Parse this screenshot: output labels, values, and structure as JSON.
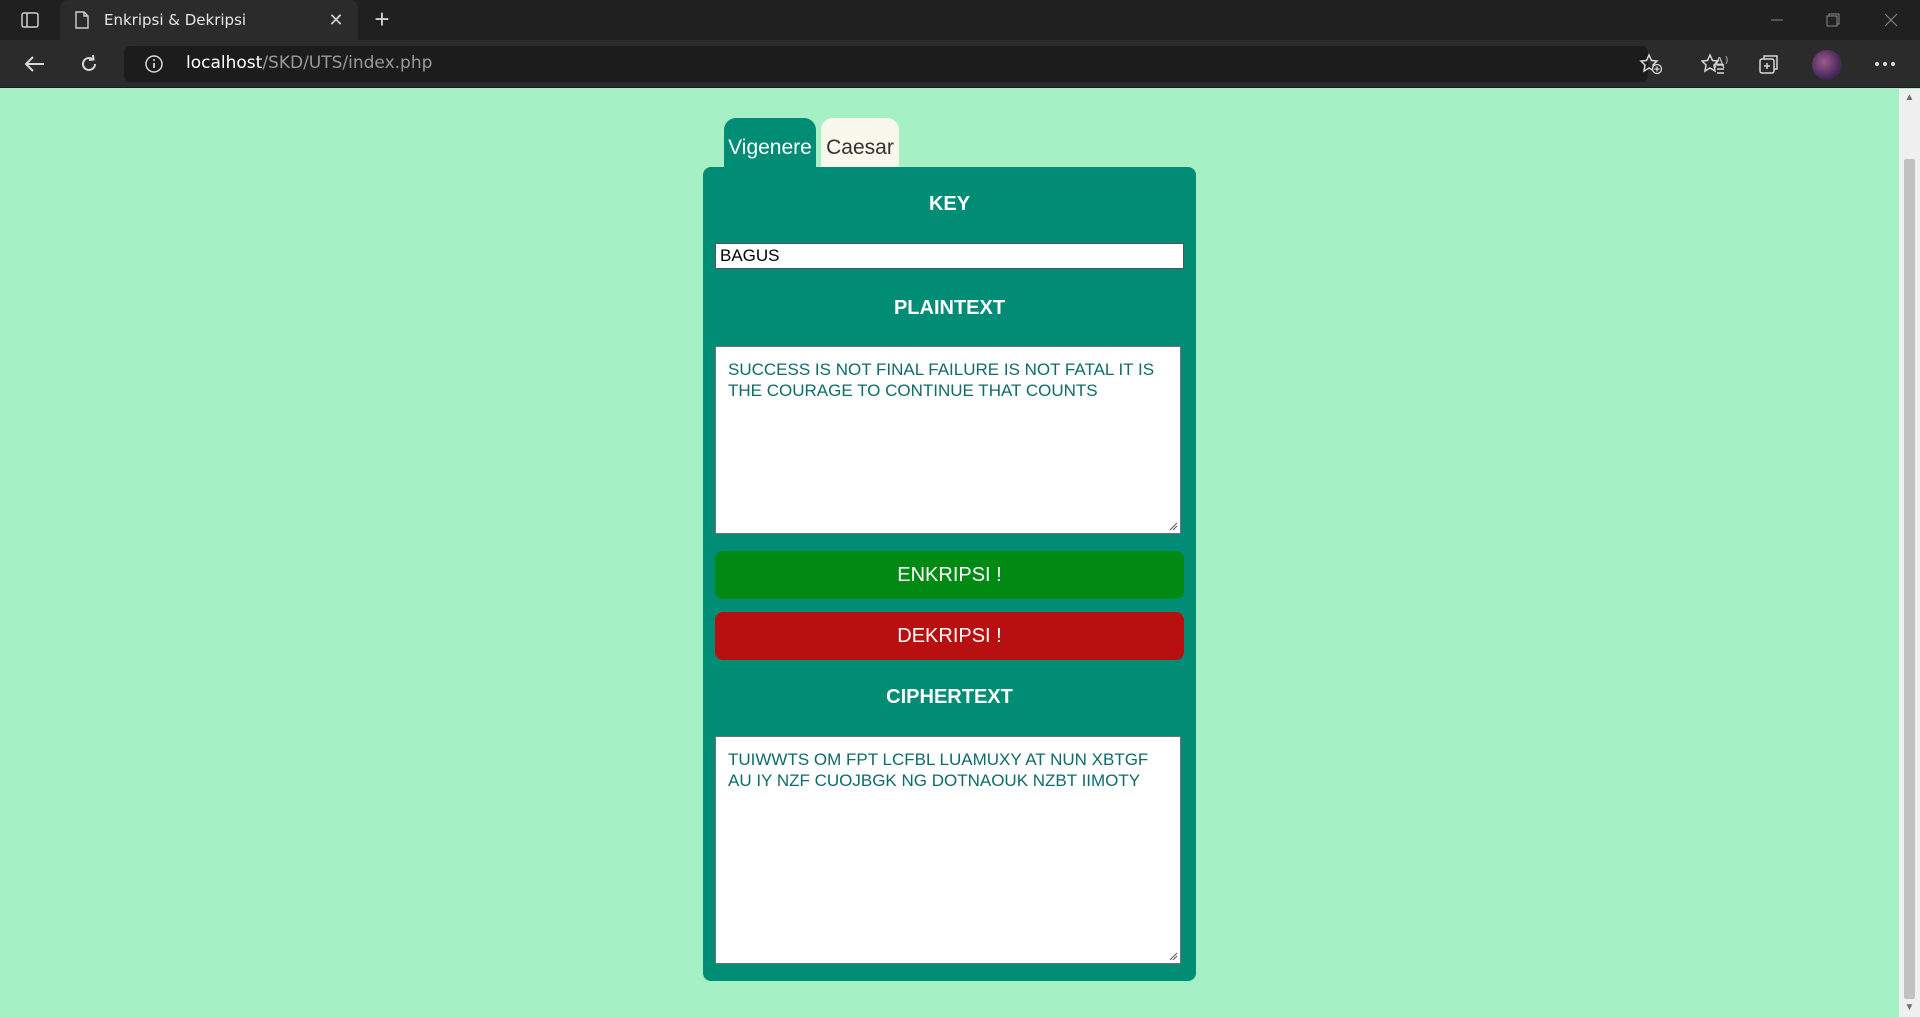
{
  "browser": {
    "tab_title": "Enkripsi & Dekripsi",
    "url_host": "localhost",
    "url_path": "/SKD/UTS/index.php",
    "read_aloud_icon_text": "A⁾"
  },
  "cipher_tabs": [
    {
      "label": "Vigenere",
      "active": true
    },
    {
      "label": "Caesar",
      "active": false
    }
  ],
  "form": {
    "key_label": "KEY",
    "key_value": "BAGUS",
    "plaintext_label": "PLAINTEXT",
    "plaintext_value": "SUCCESS IS NOT FINAL FAILURE IS NOT FATAL IT IS THE COURAGE TO CONTINUE THAT COUNTS",
    "encrypt_label": "ENKRIPSI !",
    "decrypt_label": "DEKRIPSI !",
    "ciphertext_label": "CIPHERTEXT",
    "ciphertext_value": "TUIWWTS OM FPT LCFBL LUAMUXY AT NUN XBTGF AU IY NZF CUOJBGK NG DOTNAOUK NZBT IIMOTY"
  },
  "colors": {
    "page_bg": "#a6f0c6",
    "panel": "#008c75",
    "encrypt": "#008a14",
    "decrypt": "#b81010",
    "inactive_tab": "#f8f8ec"
  }
}
